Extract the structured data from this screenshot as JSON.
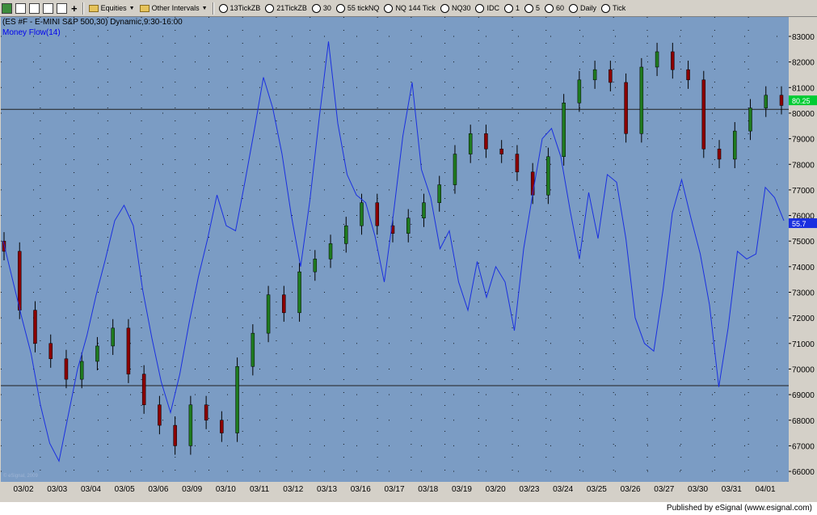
{
  "toolbar": {
    "equities_label": "Equities",
    "intervals_label": "Other Intervals",
    "buttons": [
      "13TickZB",
      "21TickZB",
      "30",
      "55 tickNQ",
      "NQ 144 Tick",
      "NQ30",
      "IDC",
      "1",
      "5",
      "60",
      "Daily",
      "Tick"
    ]
  },
  "chart": {
    "symbol_title": "(ES #F - E-MINI S&P 500,30) Dynamic,9:30-16:00",
    "indicator_title": "Money Flow(14)",
    "watermark": "© eSignal, 2009",
    "current_price_label": "80.25",
    "indicator_value_label": "55.7",
    "colors": {
      "background": "#7b9cc4",
      "money_flow": "#1a2fe0",
      "up_candle": "#1f7a1f",
      "down_candle": "#8b0000"
    }
  },
  "chart_data": {
    "type": "line",
    "y_tick_labels": [
      "83000",
      "82000",
      "81000",
      "80000",
      "79000",
      "78000",
      "77000",
      "76000",
      "75000",
      "74000",
      "73000",
      "72000",
      "71000",
      "70000",
      "69000",
      "68000",
      "67000",
      "66000"
    ],
    "x_tick_labels": [
      "03/02",
      "03/03",
      "03/04",
      "03/05",
      "03/06",
      "03/09",
      "03/10",
      "03/11",
      "03/12",
      "03/13",
      "03/16",
      "03/17",
      "03/18",
      "03/19",
      "03/20",
      "03/23",
      "03/24",
      "03/25",
      "03/26",
      "03/27",
      "03/30",
      "03/31",
      "04/01"
    ],
    "ylim": [
      65600,
      83400
    ],
    "horizontal_lines": [
      80150,
      69350
    ],
    "price_closes": [
      74600,
      72300,
      71000,
      70400,
      69600,
      70300,
      70900,
      71600,
      69800,
      68600,
      67800,
      67000,
      68600,
      68000,
      67500,
      70100,
      71400,
      72900,
      72200,
      73800,
      74300,
      74900,
      75600,
      76500,
      75600,
      75300,
      75900,
      76500,
      77200,
      78400,
      79200,
      78600,
      78400,
      77700,
      76800,
      78300,
      80400,
      81300,
      81700,
      81200,
      79200,
      81800,
      82400,
      81700,
      81300,
      78600,
      78200,
      79300,
      80200,
      80700,
      80300
    ],
    "series": [
      {
        "name": "Money Flow(14)",
        "values": [
          75000,
          73500,
          72000,
          70600,
          68600,
          67100,
          66400,
          68200,
          70000,
          71300,
          72900,
          74300,
          75800,
          76400,
          75600,
          73100,
          71200,
          69500,
          68300,
          69800,
          71800,
          73600,
          75100,
          76800,
          75600,
          75400,
          77300,
          79300,
          81400,
          80200,
          78400,
          76000,
          74000,
          76600,
          79800,
          82800,
          79600,
          77600,
          76800,
          76500,
          75200,
          73400,
          76100,
          79100,
          81200,
          77800,
          76700,
          74700,
          75400,
          73400,
          72300,
          74200,
          72800,
          74000,
          73400,
          71500,
          74700,
          76900,
          79000,
          79400,
          78300,
          76200,
          74300,
          76900,
          75100,
          77600,
          77300,
          75100,
          72000,
          71000,
          70700,
          73100,
          76100,
          77400,
          75900,
          74500,
          72500,
          69300,
          71600,
          74600,
          74300,
          74500,
          77100,
          76700,
          75800
        ],
        "color": "#1a2fe0"
      }
    ],
    "grid": true,
    "axis_position": "right"
  }
}
